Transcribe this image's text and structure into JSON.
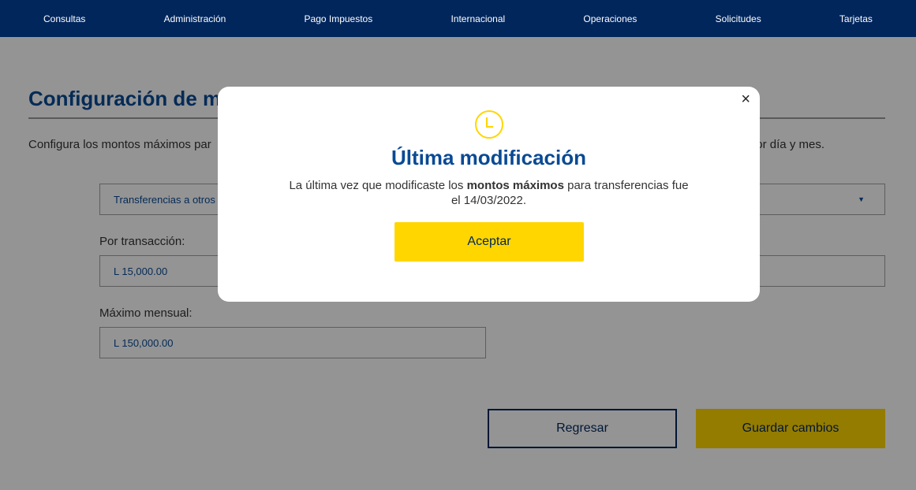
{
  "nav": {
    "items": [
      "Consultas",
      "Administración",
      "Pago Impuestos",
      "Internacional",
      "Operaciones",
      "Solicitudes",
      "Tarjetas"
    ]
  },
  "page": {
    "title": "Configuración de mo",
    "description_left": "Configura los montos máximos par",
    "description_right": "or día y mes."
  },
  "form": {
    "type_select": {
      "value": "Transferencias a otros",
      "icon": "caret-down-icon"
    },
    "per_transaction": {
      "label": "Por transacción:",
      "value": "L 15,000.00"
    },
    "monthly_max": {
      "label": "Máximo mensual:",
      "value": "L 150,000.00"
    }
  },
  "actions": {
    "back_label": "Regresar",
    "save_label": "Guardar cambios"
  },
  "modal": {
    "icon": "clock-icon",
    "close_glyph": "×",
    "title": "Última modificación",
    "body_before": "La última vez que modificaste los ",
    "body_bold": "montos máximos",
    "body_after": " para transferencias fue el 14/03/2022.",
    "accept_label": "Aceptar"
  },
  "colors": {
    "nav_bg": "#00265c",
    "brand_blue": "#0a4a94",
    "accent_yellow": "#ffd600"
  }
}
